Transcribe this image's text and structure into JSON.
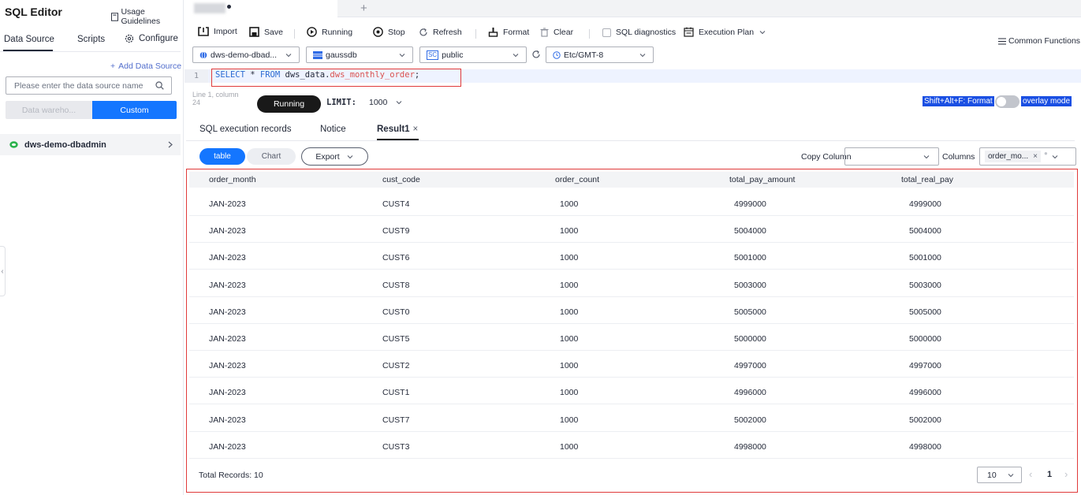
{
  "sidebar": {
    "title": "SQL Editor",
    "usage_guidelines": "Usage Guidelines",
    "tabs": {
      "data_source": "Data Source",
      "scripts": "Scripts",
      "configure": "Configure"
    },
    "add_data_source": "Add Data Source",
    "search_placeholder": "Please enter the data source name",
    "segments": {
      "warehouse": "Data wareho...",
      "custom": "Custom"
    },
    "datasource_item": "dws-demo-dbadmin",
    "collapse_glyph": "‹"
  },
  "tabbar": {
    "add_glyph": "+"
  },
  "toolbar": {
    "import": "Import",
    "save": "Save",
    "running": "Running",
    "stop": "Stop",
    "refresh": "Refresh",
    "format": "Format",
    "clear": "Clear",
    "sql_diagnostics": "SQL diagnostics",
    "execution_plan": "Execution Plan",
    "common_functions": "Common Functions"
  },
  "selectors": {
    "datasource": "dws-demo-dbad...",
    "database": "gaussdb",
    "schema_badge": "SC",
    "schema": "public",
    "timezone": "Etc/GMT-8"
  },
  "editor": {
    "line_number": "1",
    "sql_select": "SELECT",
    "sql_star": " * ",
    "sql_from": "FROM",
    "sql_schema": " dws_data.",
    "sql_table": "dws_monthly_order",
    "sql_end": ";",
    "cursor_position": "Line 1, column 24",
    "run_button": "Running",
    "limit_label": "LIMIT:",
    "limit_value": "1000",
    "format_hint": "Shift+Alt+F: Format",
    "overlay_mode": "overlay mode"
  },
  "result_tabs": {
    "records": "SQL execution records",
    "notice": "Notice",
    "result": "Result1",
    "close_glyph": "×"
  },
  "result_toolbar": {
    "table": "table",
    "chart": "Chart",
    "export": "Export",
    "copy_column": "Copy Column",
    "columns": "Columns",
    "columns_tag": "order_mo...",
    "tag_close": "×"
  },
  "table": {
    "headers": [
      "order_month",
      "cust_code",
      "order_count",
      "total_pay_amount",
      "total_real_pay"
    ],
    "rows": [
      [
        "JAN-2023",
        "CUST4",
        "1000",
        "4999000",
        "4999000"
      ],
      [
        "JAN-2023",
        "CUST9",
        "1000",
        "5004000",
        "5004000"
      ],
      [
        "JAN-2023",
        "CUST6",
        "1000",
        "5001000",
        "5001000"
      ],
      [
        "JAN-2023",
        "CUST8",
        "1000",
        "5003000",
        "5003000"
      ],
      [
        "JAN-2023",
        "CUST0",
        "1000",
        "5005000",
        "5005000"
      ],
      [
        "JAN-2023",
        "CUST5",
        "1000",
        "5000000",
        "5000000"
      ],
      [
        "JAN-2023",
        "CUST2",
        "1000",
        "4997000",
        "4997000"
      ],
      [
        "JAN-2023",
        "CUST1",
        "1000",
        "4996000",
        "4996000"
      ],
      [
        "JAN-2023",
        "CUST7",
        "1000",
        "5002000",
        "5002000"
      ],
      [
        "JAN-2023",
        "CUST3",
        "1000",
        "4998000",
        "4998000"
      ]
    ],
    "total_records": "Total Records: 10"
  },
  "pagination": {
    "page_size": "10",
    "current_page": "1",
    "prev_glyph": "‹",
    "next_glyph": "›"
  },
  "colors": {
    "primary": "#1476ff",
    "highlight_border": "#e03a3a",
    "dark_pill": "#191919"
  }
}
